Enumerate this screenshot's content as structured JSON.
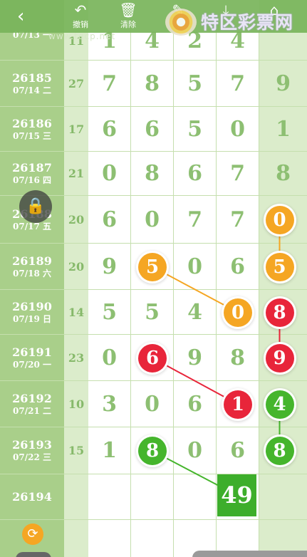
{
  "toolbar": {
    "back_icon": "back-chevron-icon",
    "undo_label": "撤销",
    "undo_icon": "undo-icon",
    "clear_label": "清除",
    "clear_icon": "trash-icon",
    "edit_icon": "edit-icon",
    "download_icon": "download-icon",
    "share_icon": "share-icon",
    "logo_text": "特区彩票网",
    "logo_sub": "www.tqcp.net"
  },
  "rows": [
    {
      "issue": "",
      "date": "07/13 一",
      "sum": "11",
      "nums": [
        "1",
        "4",
        "2",
        "4"
      ],
      "tail": ""
    },
    {
      "issue": "26185",
      "date": "07/14 二",
      "sum": "27",
      "nums": [
        "7",
        "8",
        "5",
        "7"
      ],
      "tail": "9"
    },
    {
      "issue": "26186",
      "date": "07/15 三",
      "sum": "17",
      "nums": [
        "6",
        "6",
        "5",
        "0"
      ],
      "tail": "1"
    },
    {
      "issue": "26187",
      "date": "07/16 四",
      "sum": "21",
      "nums": [
        "0",
        "8",
        "6",
        "7"
      ],
      "tail": "8"
    },
    {
      "issue": "26188",
      "date": "07/17 五",
      "sum": "20",
      "nums": [
        "6",
        "0",
        "7",
        "7"
      ],
      "tail": "0"
    },
    {
      "issue": "26189",
      "date": "07/18 六",
      "sum": "20",
      "nums": [
        "9",
        "5",
        "0",
        "6"
      ],
      "tail": "5"
    },
    {
      "issue": "26190",
      "date": "07/19 日",
      "sum": "14",
      "nums": [
        "5",
        "5",
        "4",
        "0"
      ],
      "tail": "8"
    },
    {
      "issue": "26191",
      "date": "07/20 一",
      "sum": "23",
      "nums": [
        "0",
        "6",
        "9",
        "8"
      ],
      "tail": "9"
    },
    {
      "issue": "26192",
      "date": "07/21 二",
      "sum": "10",
      "nums": [
        "3",
        "0",
        "6",
        "1"
      ],
      "tail": "4"
    },
    {
      "issue": "26193",
      "date": "07/22 三",
      "sum": "15",
      "nums": [
        "1",
        "8",
        "0",
        "6"
      ],
      "tail": "8"
    },
    {
      "issue": "26194",
      "date": "",
      "sum": "",
      "nums": [
        "",
        "",
        "",
        ""
      ],
      "tail": ""
    },
    {
      "issue": "",
      "date": "",
      "sum": "",
      "nums": [
        "",
        "",
        "",
        ""
      ],
      "tail": ""
    }
  ],
  "highlights": [
    {
      "row": 4,
      "col": "tail",
      "value": "0",
      "color": "orange"
    },
    {
      "row": 5,
      "col": 1,
      "value": "5",
      "color": "orange"
    },
    {
      "row": 5,
      "col": "tail",
      "value": "5",
      "color": "orange"
    },
    {
      "row": 6,
      "col": 3,
      "value": "0",
      "color": "orange"
    },
    {
      "row": 6,
      "col": "tail",
      "value": "8",
      "color": "red"
    },
    {
      "row": 7,
      "col": 1,
      "value": "6",
      "color": "red"
    },
    {
      "row": 7,
      "col": "tail",
      "value": "9",
      "color": "red"
    },
    {
      "row": 8,
      "col": 3,
      "value": "1",
      "color": "red"
    },
    {
      "row": 8,
      "col": "tail",
      "value": "4",
      "color": "green"
    },
    {
      "row": 9,
      "col": 1,
      "value": "8",
      "color": "green"
    },
    {
      "row": 9,
      "col": "tail",
      "value": "8",
      "color": "green"
    }
  ],
  "prediction": {
    "value": "49",
    "color": "#3dae2b"
  },
  "colors": {
    "orange": "#f5a623",
    "red": "#e8253a",
    "green": "#45b52c",
    "issue_bg": "#a9cf8a",
    "side_bg": "#dbeccb"
  },
  "floating": {
    "lock_icon": "lock-icon",
    "refresh_icon": "refresh-icon"
  }
}
